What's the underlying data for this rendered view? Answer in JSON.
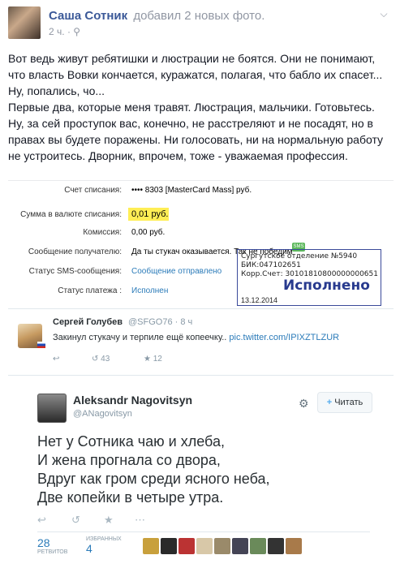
{
  "post": {
    "author": "Саша Сотник",
    "action": "добавил 2 новых фото.",
    "time": "2 ч.",
    "paragraphs": [
      "Вот ведь живут ребятишки и люстрации не боятся. Они не понимают, что власть Вовки кончается, куражатся, полагая, что бабло их спасет...",
      "Ну, попались, чо...",
      "Первые два, которые меня травят. Люстрация, мальчики. Готовьтесь. Ну, за сей проступок вас, конечно, не расстреляют и не посадят, но в правах вы будете поражены. Ни голосовать, ни на нормальную работу не устроитесь. Дворник, впрочем, тоже - уважаемая профессия."
    ]
  },
  "payment": {
    "rows": [
      {
        "label": "Счет списания:",
        "value": "•••• 8303 [MasterCard Mass]  руб."
      },
      {
        "label": "Сумма в валюте списания:",
        "value": "0,01  руб."
      },
      {
        "label": "Комиссия:",
        "value": "0,00 руб."
      },
      {
        "label": "Сообщение получателю:",
        "value": "Да ты стукач оказывается. Так не победим"
      },
      {
        "label": "Статус SMS-сообщения:",
        "value": "Сообщение отправлено"
      },
      {
        "label": "Статус платежа :",
        "value": "Исполнен"
      }
    ],
    "sms_badge": "SMS",
    "stamp": {
      "line1": "Сургутское отделение №5940",
      "line2": "БИК:047102651",
      "line3": "Корр.Счет: 30101810800000000651",
      "status": "Исполнено",
      "date": "13.12.2014"
    }
  },
  "tweet1": {
    "name": "Сергей Голубев",
    "handle": "@SFGO76 · 8 ч",
    "text": "Закинул стукачу и терпиле ещё копеечку..",
    "link": "pic.twitter.com/IPIXZTLZUR",
    "retweets": "43",
    "favorites": "12"
  },
  "tweet2": {
    "name": "Aleksandr Nagovitsyn",
    "handle": "@ANagovitsyn",
    "follow_label": "Читать",
    "lines": [
      "Нет у Сотника чаю и хлеба,",
      "И жена прогнала со двора,",
      "Вдруг как гром среди ясного неба,",
      "Две копейки в четыре утра."
    ],
    "retweets_count": "28",
    "retweets_label": "РЕТВИТОВ",
    "favorites_count": "4",
    "favorites_label": "ИЗБРАННЫХ"
  },
  "colors": {
    "fb_blue": "#3b5998",
    "twitter_blue": "#55acee",
    "highlight": "#ffee55"
  }
}
